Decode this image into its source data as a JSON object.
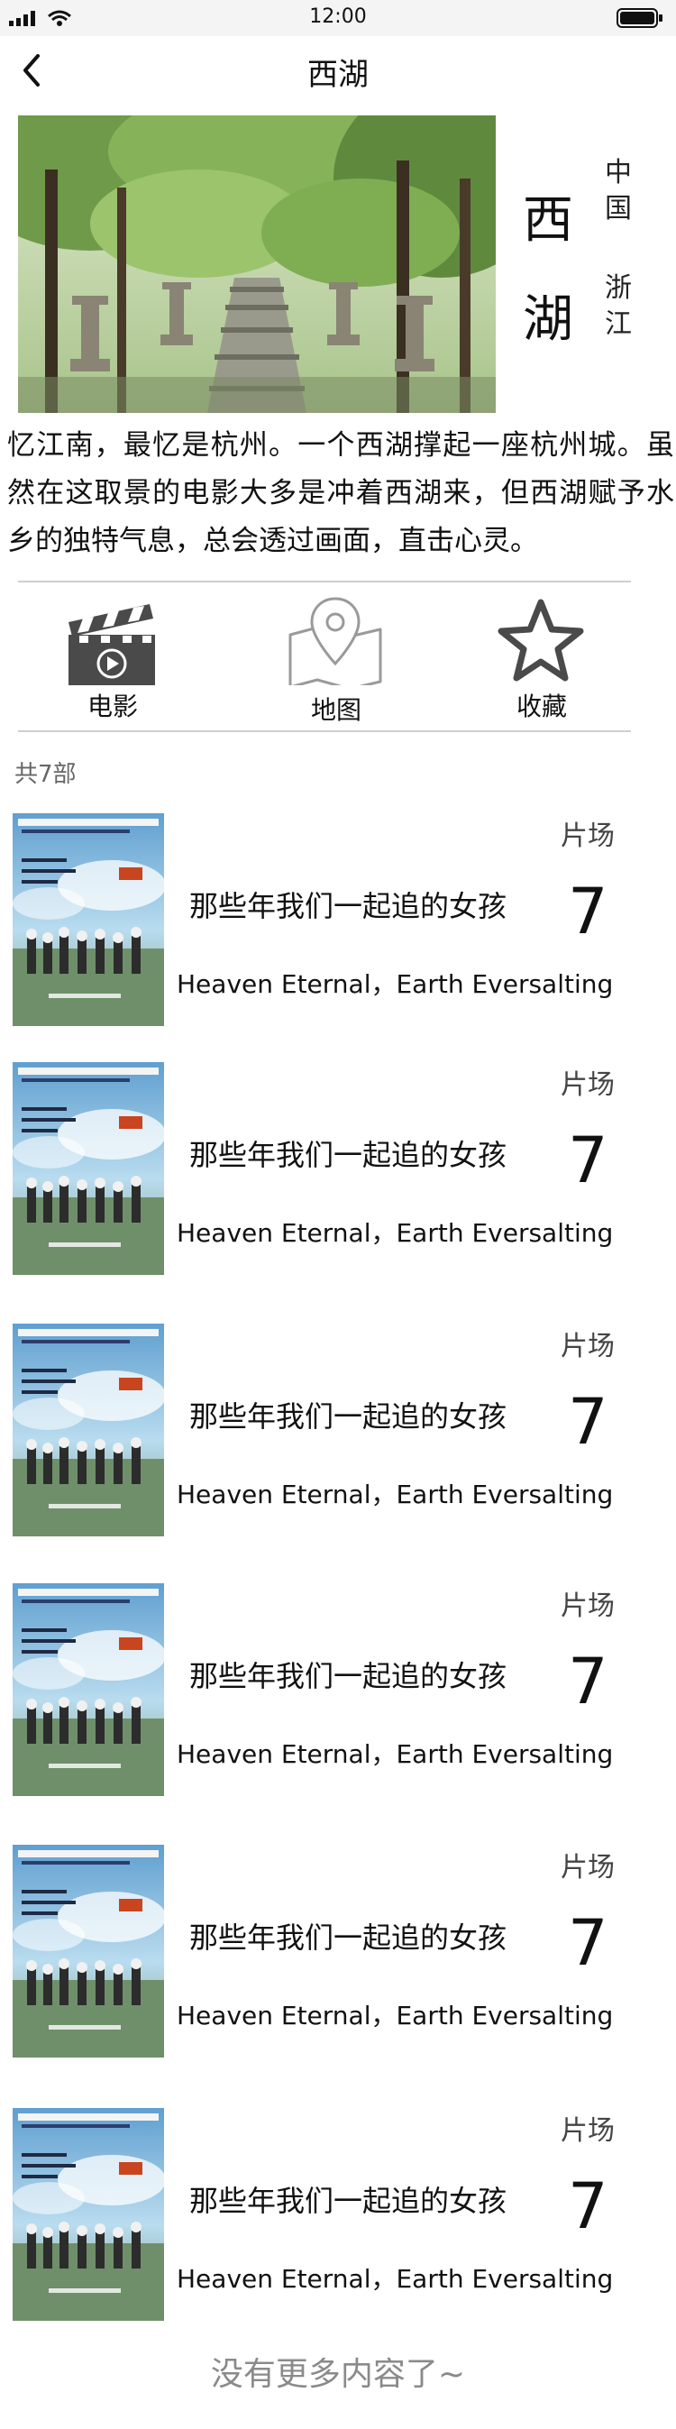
{
  "status_bar": {
    "time": "12:00"
  },
  "nav": {
    "title": "西湖"
  },
  "place": {
    "name_chars": [
      "西",
      "湖"
    ],
    "country": "中国",
    "province": "浙江"
  },
  "description": "忆江南，最忆是杭州。一个西湖撑起一座杭州城。虽然在这取景的电影大多是冲着西湖来，但西湖赋予水乡的独特气息，总会透过画面，直击心灵。",
  "actions": [
    {
      "label": "电影",
      "icon": "clapperboard-icon"
    },
    {
      "label": "地图",
      "icon": "map-pin-icon"
    },
    {
      "label": "收藏",
      "icon": "star-icon"
    }
  ],
  "count_text": "共7部",
  "films": [
    {
      "tag": "片场",
      "title": "那些年我们一起追的女孩",
      "score": "7",
      "subtitle": "Heaven Eternal，Earth Eversalting"
    },
    {
      "tag": "片场",
      "title": "那些年我们一起追的女孩",
      "score": "7",
      "subtitle": "Heaven Eternal，Earth Eversalting"
    },
    {
      "tag": "片场",
      "title": "那些年我们一起追的女孩",
      "score": "7",
      "subtitle": "Heaven Eternal，Earth Eversalting"
    },
    {
      "tag": "片场",
      "title": "那些年我们一起追的女孩",
      "score": "7",
      "subtitle": "Heaven Eternal，Earth Eversalting"
    },
    {
      "tag": "片场",
      "title": "那些年我们一起追的女孩",
      "score": "7",
      "subtitle": "Heaven Eternal，Earth Eversalting"
    },
    {
      "tag": "片场",
      "title": "那些年我们一起追的女孩",
      "score": "7",
      "subtitle": "Heaven Eternal，Earth Eversalting"
    }
  ],
  "footer": "没有更多内容了~",
  "colors": {
    "divider": "#cfcfcf",
    "icon_dark": "#4a4a4a",
    "icon_light": "#9a9a9a",
    "footer": "#8a8a8a"
  }
}
